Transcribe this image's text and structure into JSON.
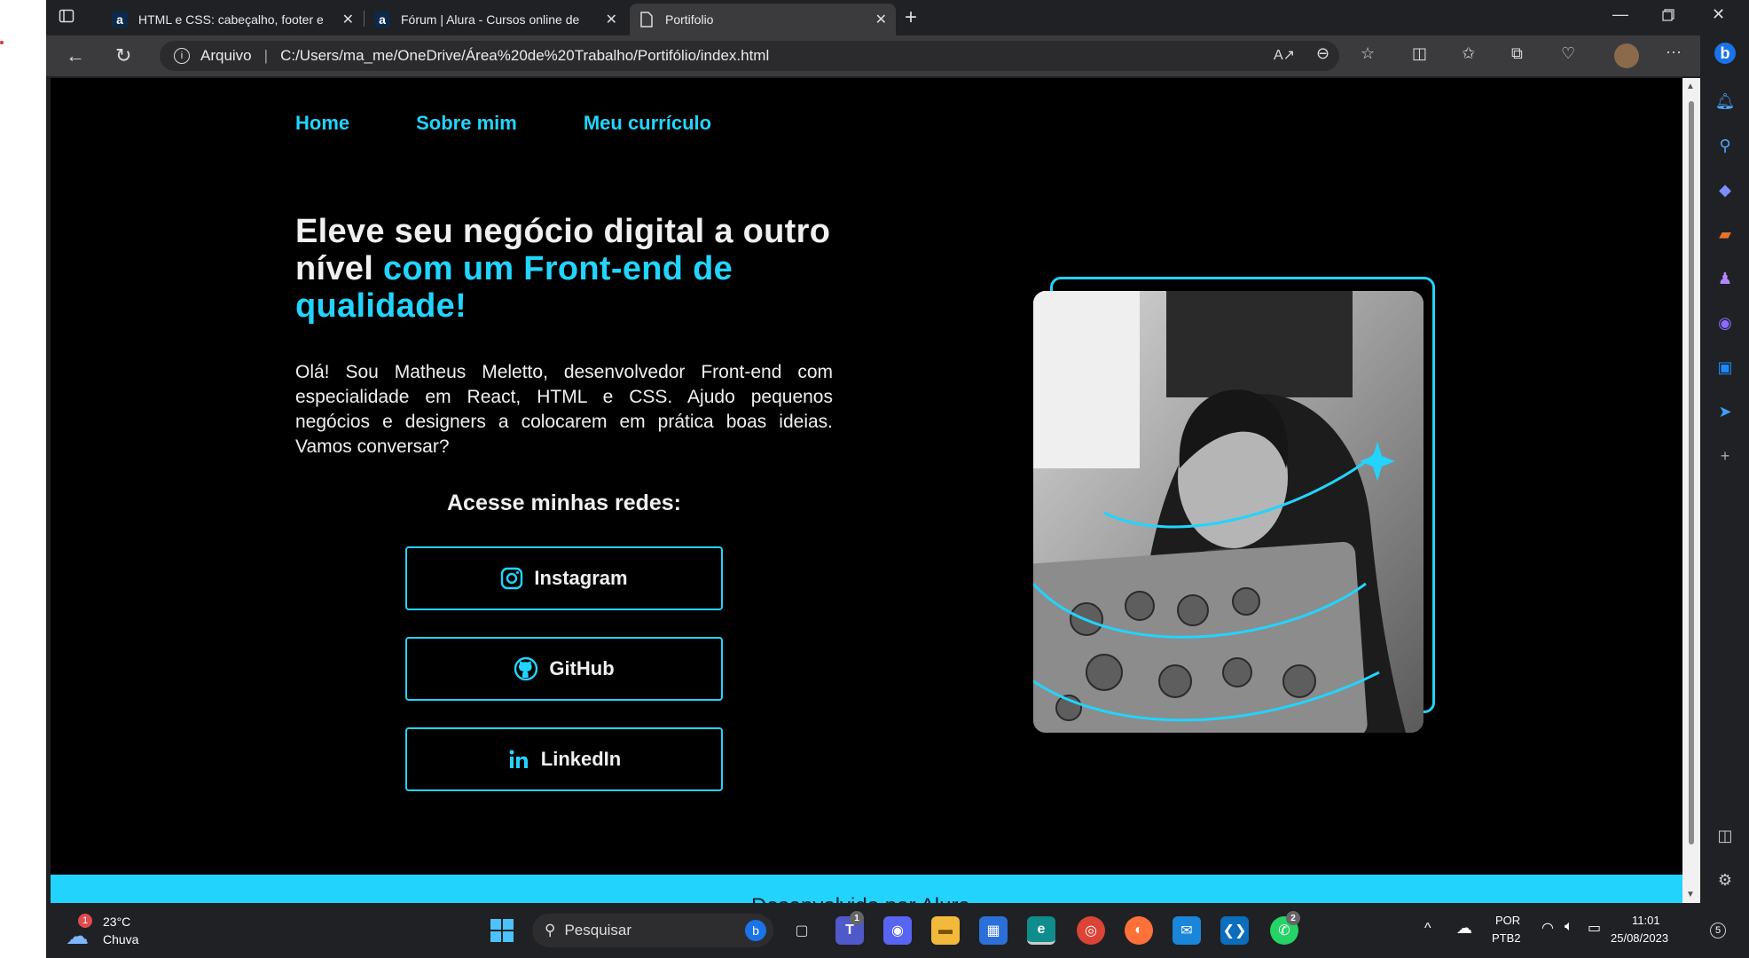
{
  "browser": {
    "tabs": [
      {
        "title": "HTML e CSS: cabeçalho, footer e",
        "favicon": "a"
      },
      {
        "title": "Fórum | Alura - Cursos online de",
        "favicon": "a"
      },
      {
        "title": "Portifolio",
        "favicon": "page-icon"
      }
    ],
    "address": {
      "label": "Arquivo",
      "url": "C:/Users/ma_me/OneDrive/Área%20de%20Trabalho/Portifólio/index.html"
    }
  },
  "page": {
    "nav": [
      "Home",
      "Sobre mim",
      "Meu currículo"
    ],
    "hero": {
      "title_plain": "Eleve seu negócio digital a outro nível ",
      "title_highlight": "com um Front-end de qualidade!",
      "text": "Olá! Sou Matheus Meletto, desenvolvedor Front-end com especialidade em React, HTML e CSS. Ajudo pequenos negócios e designers a colocarem em prática boas ideias. Vamos conversar?"
    },
    "social_heading": "Acesse minhas redes:",
    "social": [
      {
        "label": "Instagram",
        "icon": "instagram-icon"
      },
      {
        "label": "GitHub",
        "icon": "github-icon"
      },
      {
        "label": "LinkedIn",
        "icon": "linkedin-icon"
      }
    ],
    "footer_partial": "Desenvolvido por Alura"
  },
  "taskbar": {
    "weather": {
      "temp": "23°C",
      "condition": "Chuva",
      "badge": "1"
    },
    "search_placeholder": "Pesquisar",
    "teams_badge": "1",
    "whatsapp_badge": "2",
    "lang_line1": "POR",
    "lang_line2": "PTB2",
    "time": "11:01",
    "date": "25/08/2023",
    "notif_count": "5"
  },
  "colors": {
    "accent": "#22d4fd",
    "page_bg": "#000000",
    "chrome_bg": "#202124",
    "toolbar_bg": "#3b3b3d"
  }
}
